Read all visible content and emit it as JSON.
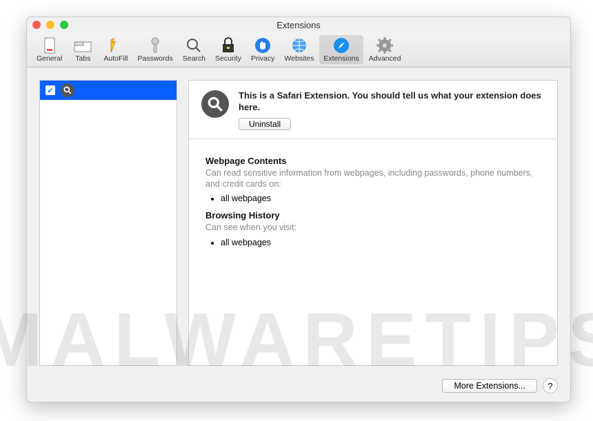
{
  "window": {
    "title": "Extensions"
  },
  "toolbar": {
    "items": [
      {
        "label": "General"
      },
      {
        "label": "Tabs"
      },
      {
        "label": "AutoFill"
      },
      {
        "label": "Passwords"
      },
      {
        "label": "Search"
      },
      {
        "label": "Security"
      },
      {
        "label": "Privacy"
      },
      {
        "label": "Websites"
      },
      {
        "label": "Extensions"
      },
      {
        "label": "Advanced"
      }
    ]
  },
  "sidebar": {
    "items": [
      {
        "checked": true,
        "name": ""
      }
    ]
  },
  "detail": {
    "description": "This is a Safari Extension. You should tell us what your extension does here.",
    "uninstall_label": "Uninstall",
    "permissions": [
      {
        "title": "Webpage Contents",
        "text": "Can read sensitive information from webpages, including passwords, phone numbers, and credit cards on:",
        "items": [
          "all webpages"
        ]
      },
      {
        "title": "Browsing History",
        "text": "Can see when you visit:",
        "items": [
          "all webpages"
        ]
      }
    ]
  },
  "footer": {
    "more_label": "More Extensions...",
    "help_label": "?"
  },
  "watermark": "MALWARETIPS"
}
